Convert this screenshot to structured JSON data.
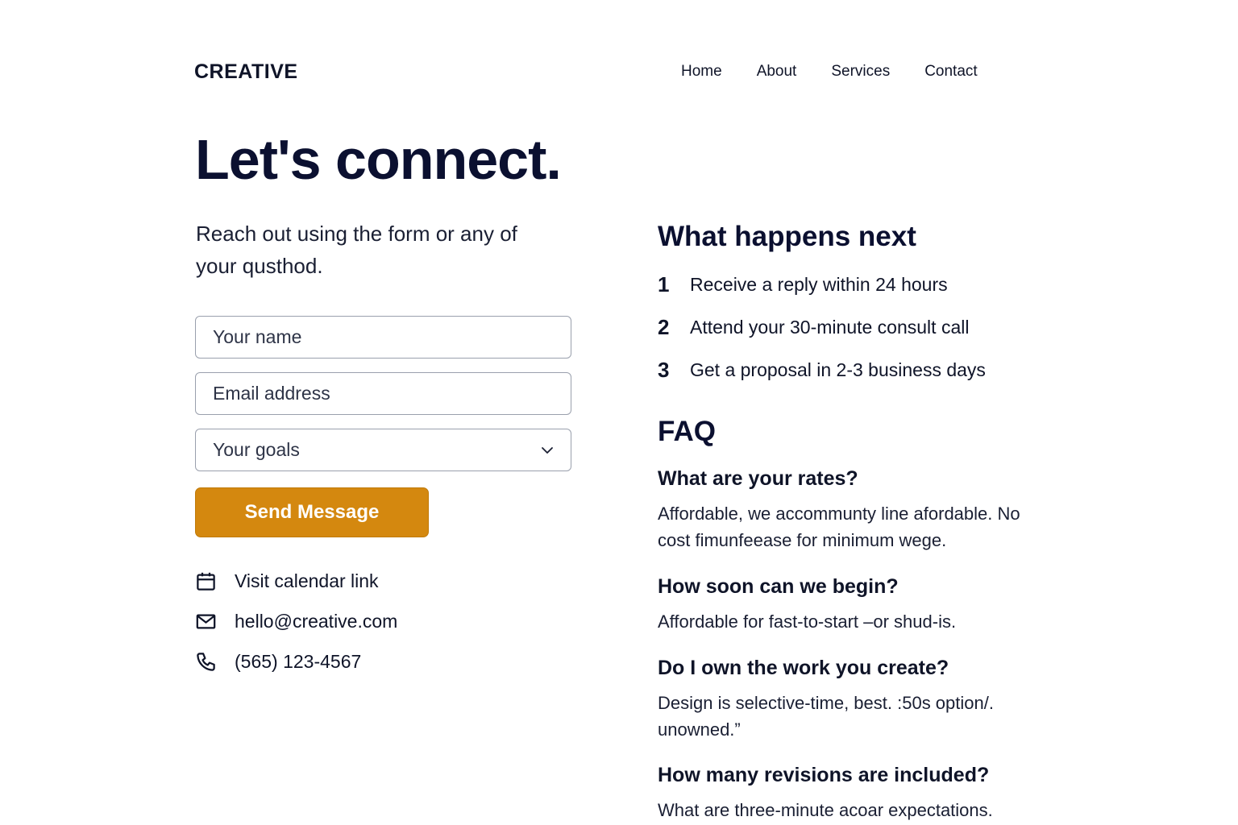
{
  "header": {
    "logo": "CREATIVE",
    "nav": [
      "Home",
      "About",
      "Services",
      "Contact"
    ]
  },
  "hero": {
    "title": "Let's connect.",
    "subtitle": "Reach out using the form or any of your qusthod."
  },
  "form": {
    "name_placeholder": "Your name",
    "email_placeholder": "Email address",
    "goals_selected": "Your goals",
    "submit_label": "Send Message",
    "accent_color": "#d4880f"
  },
  "contacts": [
    {
      "icon": "calendar-icon",
      "label": "Visit calendar link"
    },
    {
      "icon": "mail-icon",
      "label": "hello@creative.com"
    },
    {
      "icon": "phone-icon",
      "label": "(565) 123-4567"
    }
  ],
  "next_steps": {
    "title": "What happens next",
    "steps": [
      {
        "num": "1",
        "text": "Receive a reply within 24 hours"
      },
      {
        "num": "2",
        "text": "Attend your 30-minute consult call"
      },
      {
        "num": "3",
        "text": "Get a proposal in 2-3 business days"
      }
    ]
  },
  "faq": {
    "title": "FAQ",
    "items": [
      {
        "q": "What are your rates?",
        "a": "Affordable, we accommunty line afordable. No cost fimunfeease for minimum wege."
      },
      {
        "q": "How soon can we begin?",
        "a": "Affordable for fast-to-start –or shud-is."
      },
      {
        "q": "Do I own the work you create?",
        "a": "Design is selective-time, best. :50s option/. unowned.”"
      },
      {
        "q": "How many revisions are included?",
        "a": "What are three-minute acoar expectations."
      }
    ]
  }
}
